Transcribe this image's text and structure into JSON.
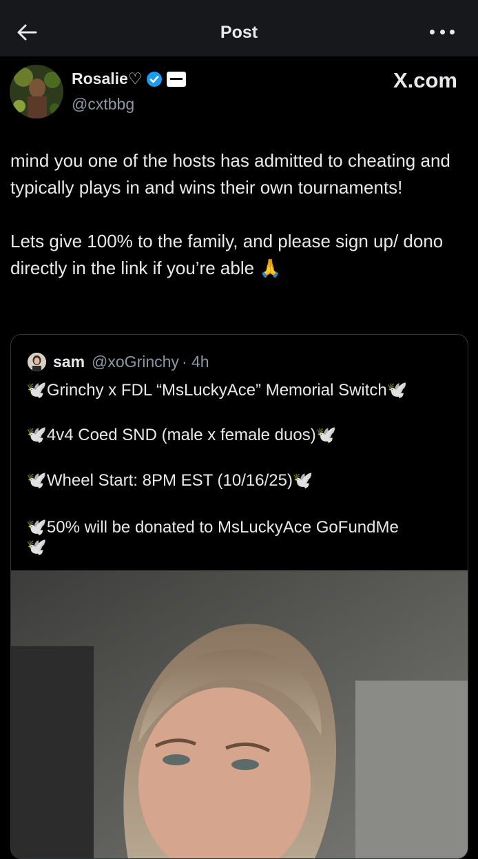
{
  "topbar": {
    "title": "Post"
  },
  "post": {
    "author_name": "Rosalie♡",
    "author_handle": "@cxtbbg",
    "brand": "X.com",
    "text_paragraph_1": "mind you one of the hosts has admitted to cheating and typically plays in and wins their own tournaments!",
    "text_paragraph_2": "Lets give 100% to the family, and please sign up/ dono directly in the link if you’re able 🙏"
  },
  "quote": {
    "name": "sam",
    "handle": "@xoGrinchy",
    "time": "· 4h",
    "lines": [
      "🕊️Grinchy x FDL “MsLuckyAce” Memorial Switch🕊️",
      "🕊️4v4 Coed SND (male x female duos)🕊️",
      "🕊️Wheel Start: 8PM EST  (10/16/25)🕊️",
      "🕊️50% will be donated to MsLuckyAce GoFundMe",
      "🕊️"
    ]
  }
}
